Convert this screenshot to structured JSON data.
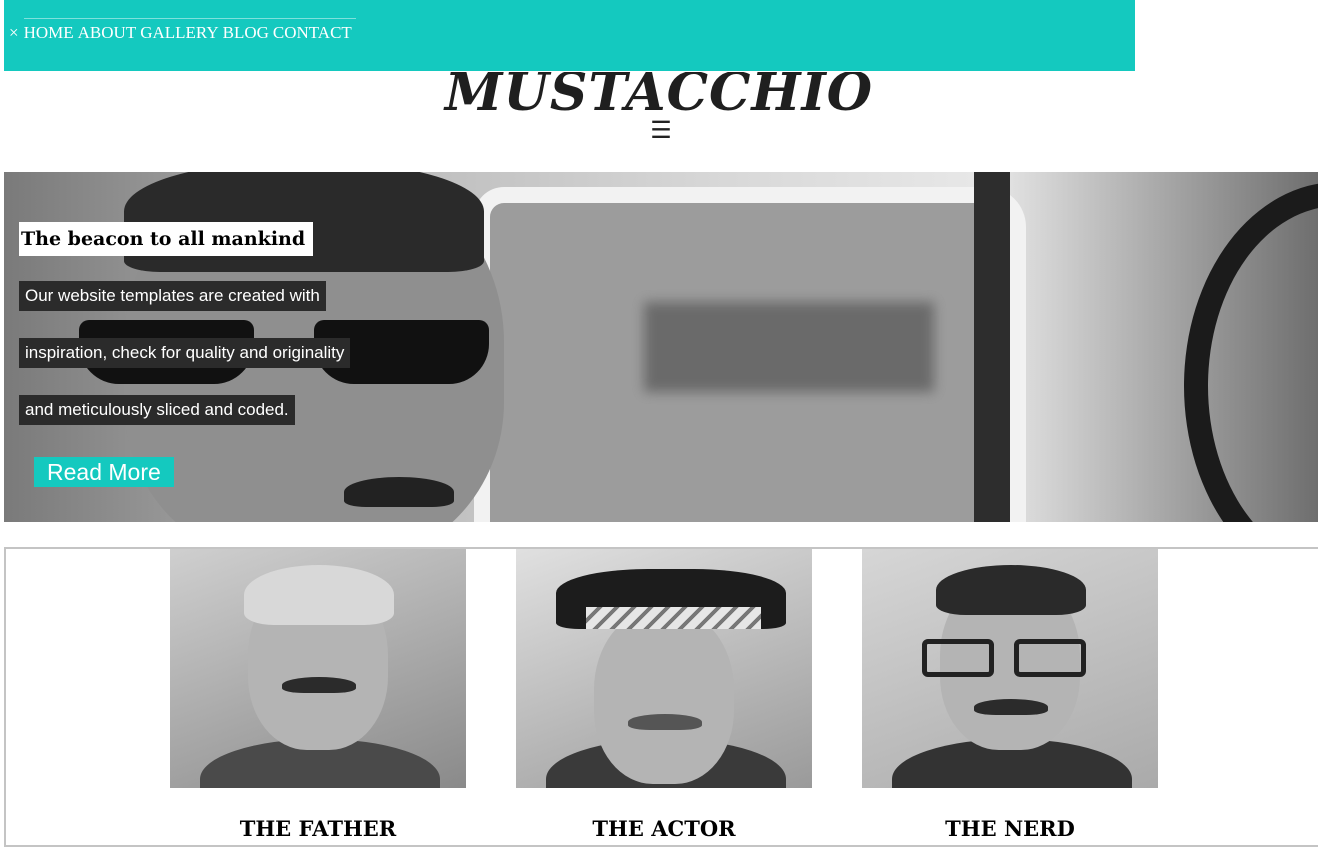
{
  "nav": {
    "close_label": "×",
    "items": [
      {
        "label": "HOME"
      },
      {
        "label": "ABOUT"
      },
      {
        "label": "GALLERY"
      },
      {
        "label": "BLOG"
      },
      {
        "label": "CONTACT"
      }
    ]
  },
  "logo": {
    "text": "MUSTACCHIO"
  },
  "menu": {
    "icon": "hamburger-icon",
    "glyph": "☰"
  },
  "hero": {
    "title": "The beacon to all mankind",
    "lines": [
      "Our website templates are created with",
      "inspiration, check for quality and originality",
      "and meticulously sliced and coded."
    ],
    "button_label": "Read More"
  },
  "team": {
    "members": [
      {
        "name": "THE FATHER"
      },
      {
        "name": "THE ACTOR"
      },
      {
        "name": "THE NERD"
      }
    ]
  },
  "colors": {
    "accent": "#14c9bf",
    "text": "#000000",
    "caption_bg": "#2b2b2b"
  }
}
